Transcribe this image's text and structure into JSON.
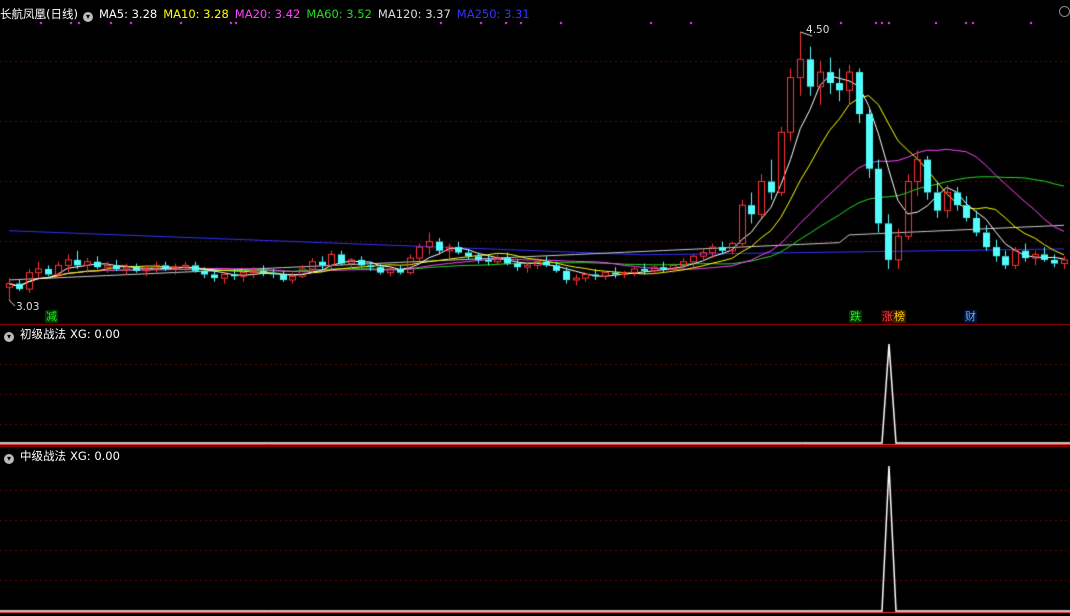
{
  "main_panel": {
    "stock_name": "长航凤凰(日线)",
    "indicators": [
      {
        "label": "MA5: 3.28",
        "color": "#ffffff"
      },
      {
        "label": "MA10: 3.28",
        "color": "#ffff00"
      },
      {
        "label": "MA20: 3.42",
        "color": "#ff44ff"
      },
      {
        "label": "MA60: 3.52",
        "color": "#22dd22"
      },
      {
        "label": "MA120: 3.37",
        "color": "#dddddd"
      },
      {
        "label": "MA250: 3.31",
        "color": "#3333ff"
      }
    ],
    "max_price_label": "4.50",
    "min_price_label": "3.03",
    "badges": [
      {
        "text": "减",
        "color": "#22ee22",
        "bg": "#003300"
      },
      {
        "text": "跌",
        "color": "#22ee22",
        "bg": "#003300"
      },
      {
        "text": "涨",
        "color": "#ff4444",
        "bg": "#330000"
      },
      {
        "text": "榜",
        "color": "#ffcc00",
        "bg": "#332200"
      },
      {
        "text": "财",
        "color": "#66aaff",
        "bg": "#001133"
      }
    ]
  },
  "sub_panel_1": {
    "title": "初级战法",
    "indicator": "XG: 0.00"
  },
  "sub_panel_2": {
    "title": "中级战法",
    "indicator": "XG: 0.00"
  },
  "chart_data": {
    "type": "candlestick",
    "price_range": [
      3.03,
      4.5
    ],
    "candle_colors": {
      "up": "#ff3232",
      "down": "#54fcfc"
    },
    "candles": [
      [
        3.1,
        3.15,
        3.03,
        3.12
      ],
      [
        3.12,
        3.14,
        3.08,
        3.09
      ],
      [
        3.09,
        3.2,
        3.07,
        3.18
      ],
      [
        3.18,
        3.24,
        3.15,
        3.2
      ],
      [
        3.2,
        3.22,
        3.16,
        3.17
      ],
      [
        3.17,
        3.24,
        3.15,
        3.22
      ],
      [
        3.22,
        3.28,
        3.18,
        3.25
      ],
      [
        3.25,
        3.3,
        3.2,
        3.22
      ],
      [
        3.22,
        3.26,
        3.18,
        3.24
      ],
      [
        3.24,
        3.27,
        3.2,
        3.21
      ],
      [
        3.21,
        3.24,
        3.18,
        3.22
      ],
      [
        3.22,
        3.25,
        3.19,
        3.2
      ],
      [
        3.2,
        3.23,
        3.17,
        3.21
      ],
      [
        3.21,
        3.23,
        3.18,
        3.19
      ],
      [
        3.19,
        3.22,
        3.16,
        3.2
      ],
      [
        3.2,
        3.24,
        3.18,
        3.22
      ],
      [
        3.22,
        3.24,
        3.19,
        3.2
      ],
      [
        3.2,
        3.23,
        3.17,
        3.21
      ],
      [
        3.21,
        3.24,
        3.19,
        3.22
      ],
      [
        3.22,
        3.24,
        3.18,
        3.19
      ],
      [
        3.19,
        3.21,
        3.15,
        3.17
      ],
      [
        3.17,
        3.2,
        3.13,
        3.15
      ],
      [
        3.15,
        3.18,
        3.12,
        3.17
      ],
      [
        3.17,
        3.2,
        3.14,
        3.16
      ],
      [
        3.16,
        3.19,
        3.13,
        3.18
      ],
      [
        3.18,
        3.21,
        3.15,
        3.19
      ],
      [
        3.19,
        3.22,
        3.16,
        3.18
      ],
      [
        3.18,
        3.2,
        3.15,
        3.17
      ],
      [
        3.17,
        3.19,
        3.13,
        3.14
      ],
      [
        3.14,
        3.18,
        3.12,
        3.16
      ],
      [
        3.16,
        3.22,
        3.15,
        3.2
      ],
      [
        3.2,
        3.26,
        3.18,
        3.24
      ],
      [
        3.24,
        3.27,
        3.2,
        3.22
      ],
      [
        3.22,
        3.3,
        3.2,
        3.28
      ],
      [
        3.28,
        3.3,
        3.22,
        3.23
      ],
      [
        3.23,
        3.26,
        3.2,
        3.25
      ],
      [
        3.25,
        3.27,
        3.21,
        3.22
      ],
      [
        3.22,
        3.24,
        3.19,
        3.21
      ],
      [
        3.21,
        3.23,
        3.17,
        3.18
      ],
      [
        3.18,
        3.21,
        3.16,
        3.2
      ],
      [
        3.2,
        3.22,
        3.17,
        3.18
      ],
      [
        3.18,
        3.28,
        3.17,
        3.26
      ],
      [
        3.26,
        3.34,
        3.24,
        3.32
      ],
      [
        3.32,
        3.4,
        3.28,
        3.35
      ],
      [
        3.35,
        3.37,
        3.28,
        3.3
      ],
      [
        3.3,
        3.34,
        3.26,
        3.32
      ],
      [
        3.32,
        3.35,
        3.28,
        3.29
      ],
      [
        3.29,
        3.31,
        3.25,
        3.27
      ],
      [
        3.27,
        3.29,
        3.23,
        3.25
      ],
      [
        3.25,
        3.28,
        3.22,
        3.24
      ],
      [
        3.24,
        3.28,
        3.22,
        3.26
      ],
      [
        3.26,
        3.29,
        3.22,
        3.23
      ],
      [
        3.23,
        3.25,
        3.19,
        3.21
      ],
      [
        3.21,
        3.24,
        3.18,
        3.22
      ],
      [
        3.22,
        3.26,
        3.2,
        3.24
      ],
      [
        3.24,
        3.27,
        3.21,
        3.22
      ],
      [
        3.22,
        3.24,
        3.18,
        3.19
      ],
      [
        3.19,
        3.21,
        3.12,
        3.14
      ],
      [
        3.14,
        3.17,
        3.11,
        3.15
      ],
      [
        3.15,
        3.18,
        3.13,
        3.17
      ],
      [
        3.17,
        3.2,
        3.14,
        3.16
      ],
      [
        3.16,
        3.19,
        3.14,
        3.18
      ],
      [
        3.18,
        3.21,
        3.15,
        3.17
      ],
      [
        3.17,
        3.19,
        3.15,
        3.18
      ],
      [
        3.18,
        3.21,
        3.16,
        3.2
      ],
      [
        3.2,
        3.23,
        3.17,
        3.19
      ],
      [
        3.19,
        3.22,
        3.17,
        3.21
      ],
      [
        3.21,
        3.24,
        3.18,
        3.2
      ],
      [
        3.2,
        3.23,
        3.18,
        3.22
      ],
      [
        3.22,
        3.26,
        3.2,
        3.24
      ],
      [
        3.24,
        3.28,
        3.21,
        3.27
      ],
      [
        3.27,
        3.31,
        3.24,
        3.29
      ],
      [
        3.29,
        3.34,
        3.26,
        3.32
      ],
      [
        3.32,
        3.35,
        3.28,
        3.3
      ],
      [
        3.3,
        3.35,
        3.28,
        3.34
      ],
      [
        3.34,
        3.58,
        3.32,
        3.55
      ],
      [
        3.55,
        3.62,
        3.45,
        3.5
      ],
      [
        3.5,
        3.72,
        3.48,
        3.68
      ],
      [
        3.68,
        3.8,
        3.58,
        3.62
      ],
      [
        3.62,
        3.98,
        3.6,
        3.95
      ],
      [
        3.95,
        4.3,
        3.9,
        4.25
      ],
      [
        4.25,
        4.5,
        4.15,
        4.35
      ],
      [
        4.35,
        4.42,
        4.15,
        4.2
      ],
      [
        4.2,
        4.34,
        4.1,
        4.28
      ],
      [
        4.28,
        4.36,
        4.16,
        4.22
      ],
      [
        4.22,
        4.3,
        4.12,
        4.18
      ],
      [
        4.18,
        4.32,
        4.1,
        4.28
      ],
      [
        4.28,
        4.3,
        4.0,
        4.05
      ],
      [
        4.05,
        4.08,
        3.7,
        3.75
      ],
      [
        3.75,
        3.8,
        3.4,
        3.45
      ],
      [
        3.45,
        3.5,
        3.2,
        3.25
      ],
      [
        3.25,
        3.42,
        3.2,
        3.38
      ],
      [
        3.38,
        3.72,
        3.36,
        3.68
      ],
      [
        3.68,
        3.85,
        3.6,
        3.8
      ],
      [
        3.8,
        3.82,
        3.58,
        3.62
      ],
      [
        3.62,
        3.68,
        3.48,
        3.52
      ],
      [
        3.52,
        3.66,
        3.48,
        3.62
      ],
      [
        3.62,
        3.65,
        3.52,
        3.55
      ],
      [
        3.55,
        3.6,
        3.46,
        3.48
      ],
      [
        3.48,
        3.52,
        3.38,
        3.4
      ],
      [
        3.4,
        3.44,
        3.3,
        3.32
      ],
      [
        3.32,
        3.36,
        3.24,
        3.27
      ],
      [
        3.27,
        3.3,
        3.2,
        3.22
      ],
      [
        3.22,
        3.32,
        3.2,
        3.3
      ],
      [
        3.3,
        3.34,
        3.24,
        3.26
      ],
      [
        3.26,
        3.3,
        3.22,
        3.28
      ],
      [
        3.28,
        3.32,
        3.24,
        3.25
      ],
      [
        3.25,
        3.28,
        3.21,
        3.23
      ],
      [
        3.23,
        3.27,
        3.2,
        3.25
      ]
    ],
    "sub_series_1": {
      "baseline": 0,
      "spike_value": 1
    },
    "sub_series_2": {
      "baseline": 0,
      "spike_value": 1
    }
  }
}
